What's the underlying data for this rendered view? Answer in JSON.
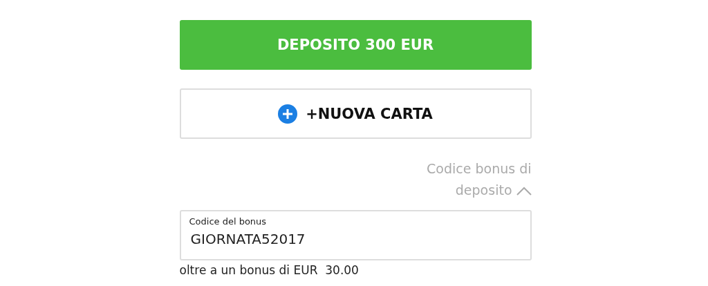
{
  "deposit_button": {
    "label": "DEPOSITO 300 EUR"
  },
  "new_card_button": {
    "label": "+NUOVA CARTA"
  },
  "bonus_toggle": {
    "label": "Codice bonus di deposito",
    "expanded": true
  },
  "bonus_field": {
    "label": "Codice del bonus",
    "value": "GIORNATA52017"
  },
  "bonus_note": "oltre a un bonus di EUR  30.00"
}
